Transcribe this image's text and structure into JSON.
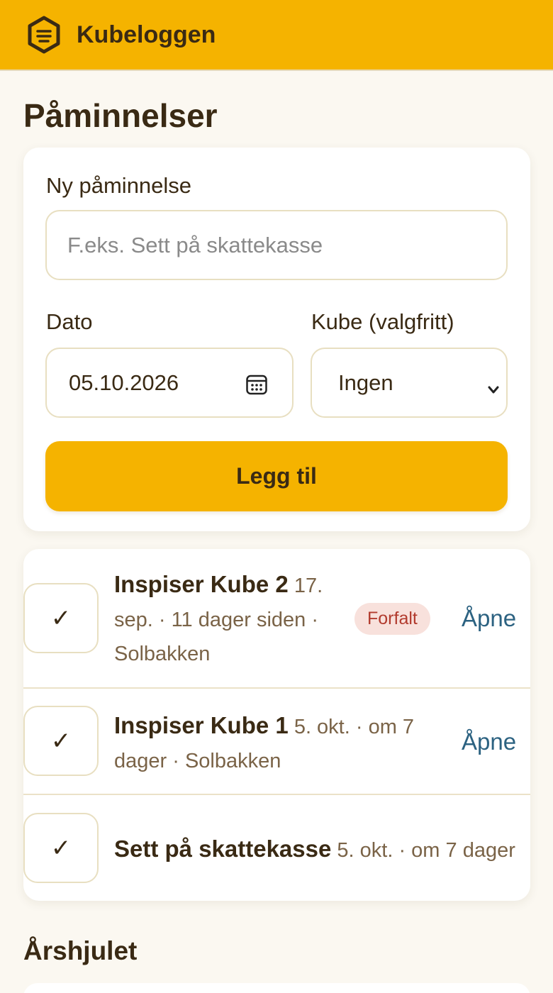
{
  "app": {
    "title": "Kubeloggen",
    "logo_icon": "beehive-hexagon-icon"
  },
  "page": {
    "title": "Påminnelser"
  },
  "form": {
    "new_label": "Ny påminnelse",
    "title_placeholder": "F.eks. Sett på skattekasse",
    "date_label": "Dato",
    "date_value": "05.10.2026",
    "hive_label": "Kube (valgfritt)",
    "hive_value": "Ingen",
    "add_button": "Legg til"
  },
  "reminders": [
    {
      "title": "Inspiser Kube 2",
      "meta_line1": "17.",
      "meta_line2": "sep. · 11 dager siden ·",
      "meta_line3": "Solbakken",
      "badge": "Forfalt",
      "action": "Åpne",
      "check": "✓"
    },
    {
      "title": "Inspiser Kube 1",
      "meta_line1": "5. okt. · om 7",
      "meta_line2": "dager · Solbakken",
      "action": "Åpne",
      "check": "✓"
    },
    {
      "title": "Sett på skattekasse",
      "meta_line1": "5. okt. · om 7 dager",
      "check": "✓"
    }
  ],
  "section": {
    "title": "Årshjulet"
  },
  "colors": {
    "accent": "#f5b300",
    "link": "#2c6281",
    "overdue": "#b23b2e"
  }
}
